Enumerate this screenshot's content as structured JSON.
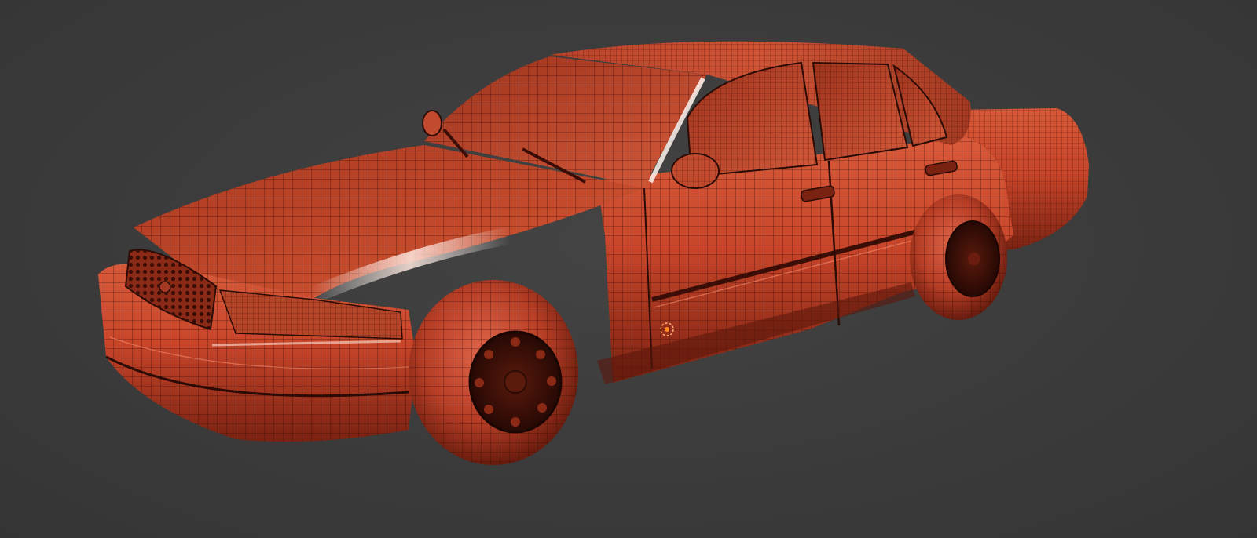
{
  "viewport": {
    "background_color": "#3a3a3a",
    "shading": "solid-wireframe-overlay"
  },
  "model": {
    "object": "sedan-car",
    "material_color": "#c8452a",
    "highlight_color": "#ff9b7e",
    "shadow_color": "#5c170c",
    "wire_color": "#2a0b05",
    "tire_color": "#b73e26",
    "rim_color": "#3a1008"
  },
  "origin_marker": {
    "icon": "object-origin-icon",
    "color": "#ff8c1a"
  }
}
